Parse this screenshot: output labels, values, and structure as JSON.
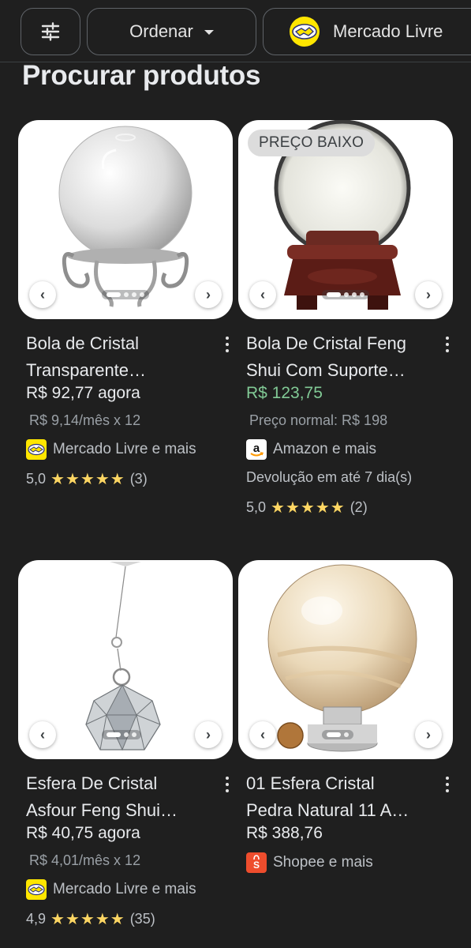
{
  "filters": {
    "filter_icon": "tune-icon",
    "sort_label": "Ordenar",
    "store_label": "Mercado Livre"
  },
  "page_title": "Procurar produtos",
  "products": [
    {
      "badge": "",
      "title_line1": "Bola de Cristal",
      "title_line2": "Transparente…",
      "price": "R$ 92,77 agora",
      "subline": "R$ 9,14/mês x 12",
      "seller": "Mercado Livre e mais",
      "note": "",
      "rating": "5,0",
      "stars": "★★★★★",
      "reviews": "(3)"
    },
    {
      "badge": "PREÇO BAIXO",
      "title_line1": "Bola De Cristal Feng",
      "title_line2": "Shui Com Suporte…",
      "price": "R$ 123,75",
      "subline": "Preço normal: R$ 198",
      "seller": "Amazon e mais",
      "note": "Devolução em até 7 dia(s)",
      "rating": "5,0",
      "stars": "★★★★★",
      "reviews": "(2)"
    },
    {
      "badge": "",
      "title_line1": "Esfera De Cristal",
      "title_line2": "Asfour Feng Shui…",
      "price": "R$ 40,75 agora",
      "subline": "R$ 4,01/mês x 12",
      "seller": "Mercado Livre e mais",
      "note": "",
      "rating": "4,9",
      "stars": "★★★★★",
      "reviews": "(35)"
    },
    {
      "badge": "",
      "title_line1": "01 Esfera Cristal",
      "title_line2": "Pedra Natural 11 A…",
      "price": "R$ 388,76",
      "subline": "",
      "seller": "Shopee e mais",
      "note": "",
      "rating": "",
      "stars": "",
      "reviews": ""
    }
  ],
  "colors": {
    "background": "#1f1f1f",
    "sale_price": "#81c995",
    "star": "#fdd663",
    "mercado_livre": "#ffe600",
    "shopee": "#ee4d2d"
  }
}
